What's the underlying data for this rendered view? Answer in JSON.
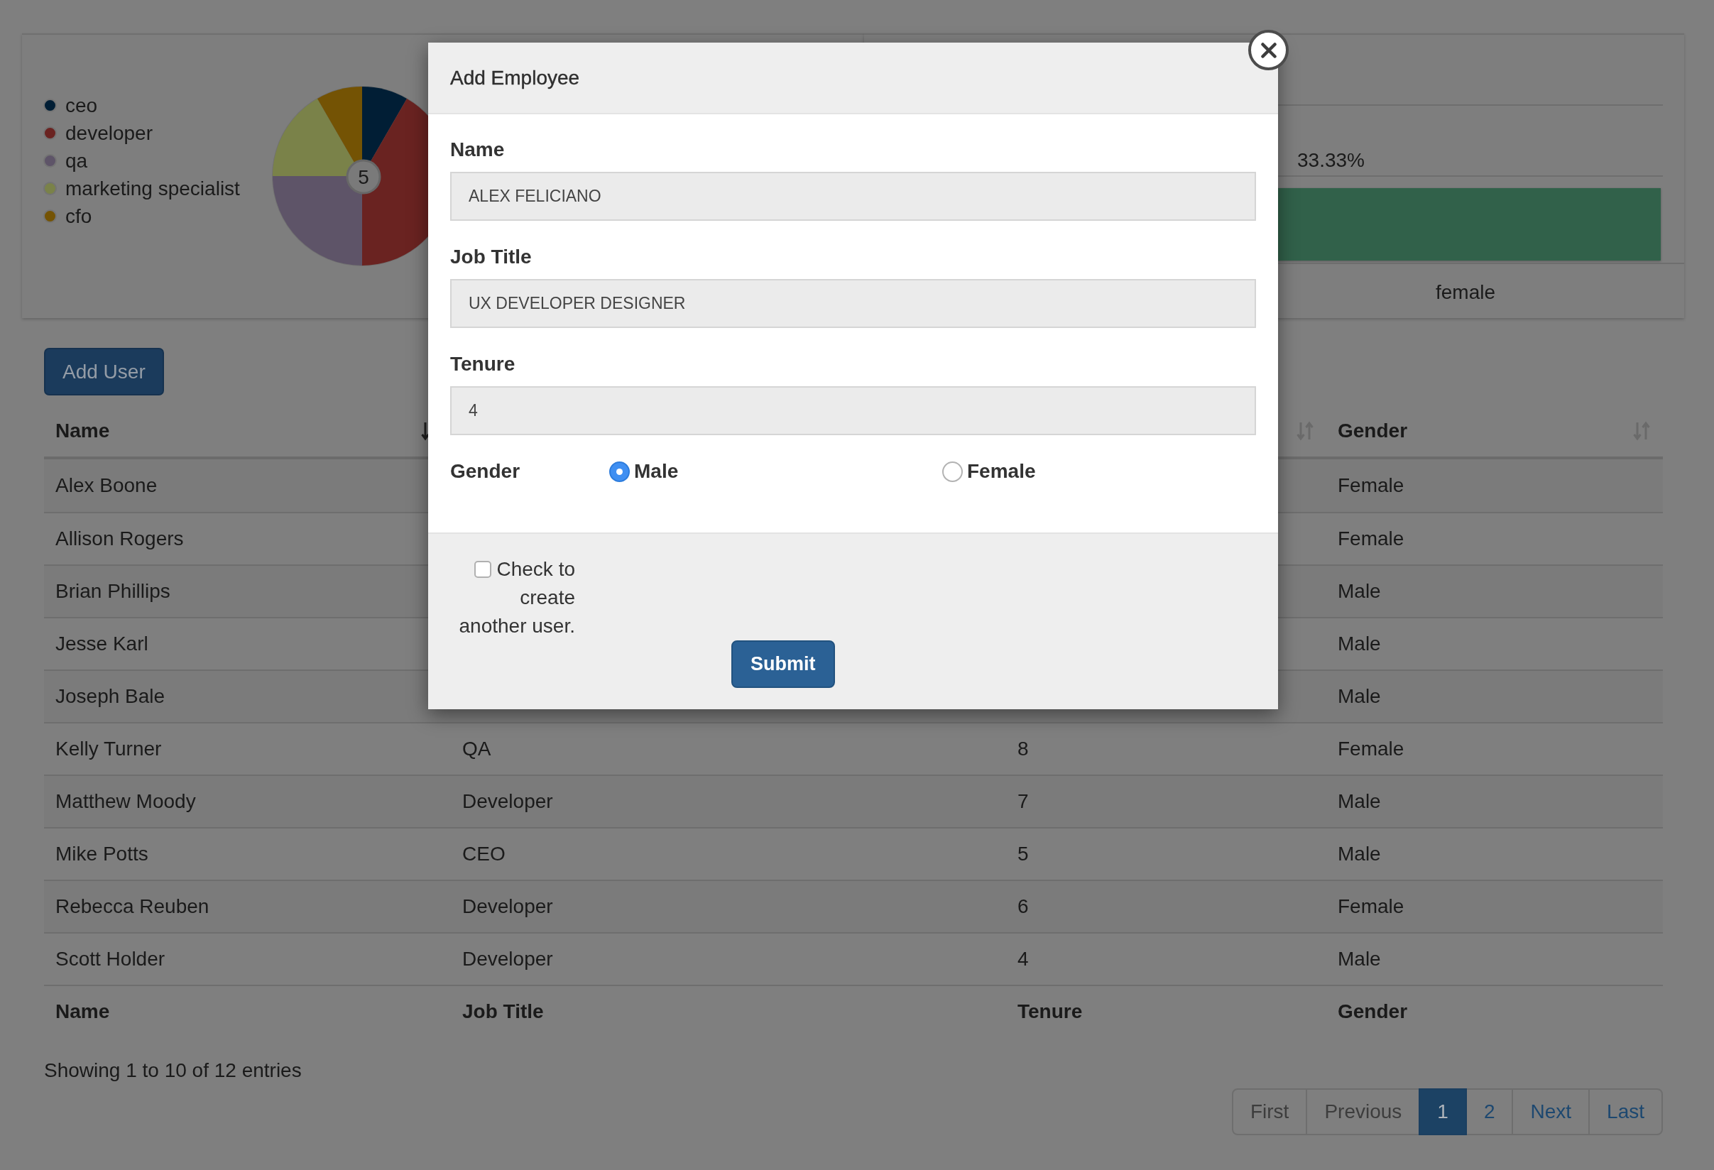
{
  "chart_panel": {
    "legend": [
      {
        "label": "ceo",
        "color": "#011e35"
      },
      {
        "label": "developer",
        "color": "#6a2321"
      },
      {
        "label": "qa",
        "color": "#5e5468"
      },
      {
        "label": "marketing specialist",
        "color": "#7a8249"
      },
      {
        "label": "cfo",
        "color": "#745304"
      }
    ],
    "center_label": "5"
  },
  "gender_panel": {
    "percent": "33.33%",
    "label": "female"
  },
  "add_user_button": "Add User",
  "table": {
    "header": {
      "name": {
        "label": "Name",
        "sorted": true
      },
      "tenure": {
        "sorted": false
      },
      "gender": {
        "label": "Gender",
        "sorted": false
      }
    },
    "rows": [
      {
        "name": "Alex Boone",
        "gender": "Female"
      },
      {
        "name": "Allison Rogers",
        "gender": "Female"
      },
      {
        "name": "Brian Phillips",
        "gender": "Male"
      },
      {
        "name": "Jesse Karl",
        "gender": "Male"
      },
      {
        "name": "Joseph Bale",
        "gender": "Male"
      },
      {
        "name": "Kelly Turner",
        "job_title": "QA",
        "tenure": "8",
        "gender": "Female"
      },
      {
        "name": "Matthew Moody",
        "job_title": "Developer",
        "tenure": "7",
        "gender": "Male"
      },
      {
        "name": "Mike Potts",
        "job_title": "CEO",
        "tenure": "5",
        "gender": "Male"
      },
      {
        "name": "Rebecca Reuben",
        "job_title": "Developer",
        "tenure": "6",
        "gender": "Female"
      },
      {
        "name": "Scott Holder",
        "job_title": "Developer",
        "tenure": "4",
        "gender": "Male"
      }
    ],
    "footer": [
      "Name",
      "Job Title",
      "Tenure",
      "Gender"
    ]
  },
  "entries_info": "Showing 1 to 10 of 12 entries",
  "pagination": [
    {
      "label": "First",
      "selected": false,
      "disabled": true
    },
    {
      "label": "Previous",
      "selected": false,
      "disabled": true
    },
    {
      "label": "1",
      "selected": true,
      "disabled": false
    },
    {
      "label": "2",
      "selected": false,
      "disabled": false
    },
    {
      "label": "Next",
      "selected": false,
      "disabled": false
    },
    {
      "label": "Last",
      "selected": false,
      "disabled": false
    }
  ],
  "modal": {
    "title": "Add Employee",
    "fields": [
      {
        "label": "Name",
        "value": "ALEX FELICIANO"
      },
      {
        "label": "Job Title",
        "value": "UX DEVELOPER DESIGNER"
      },
      {
        "label": "Tenure",
        "value": "4"
      }
    ],
    "gender": {
      "label": "Gender",
      "options": [
        {
          "label": "Male",
          "selected": true
        },
        {
          "label": "Female",
          "selected": false
        }
      ]
    },
    "another_user": {
      "label": "Check to create another user.",
      "checked": false
    },
    "submit_button": "Submit"
  }
}
